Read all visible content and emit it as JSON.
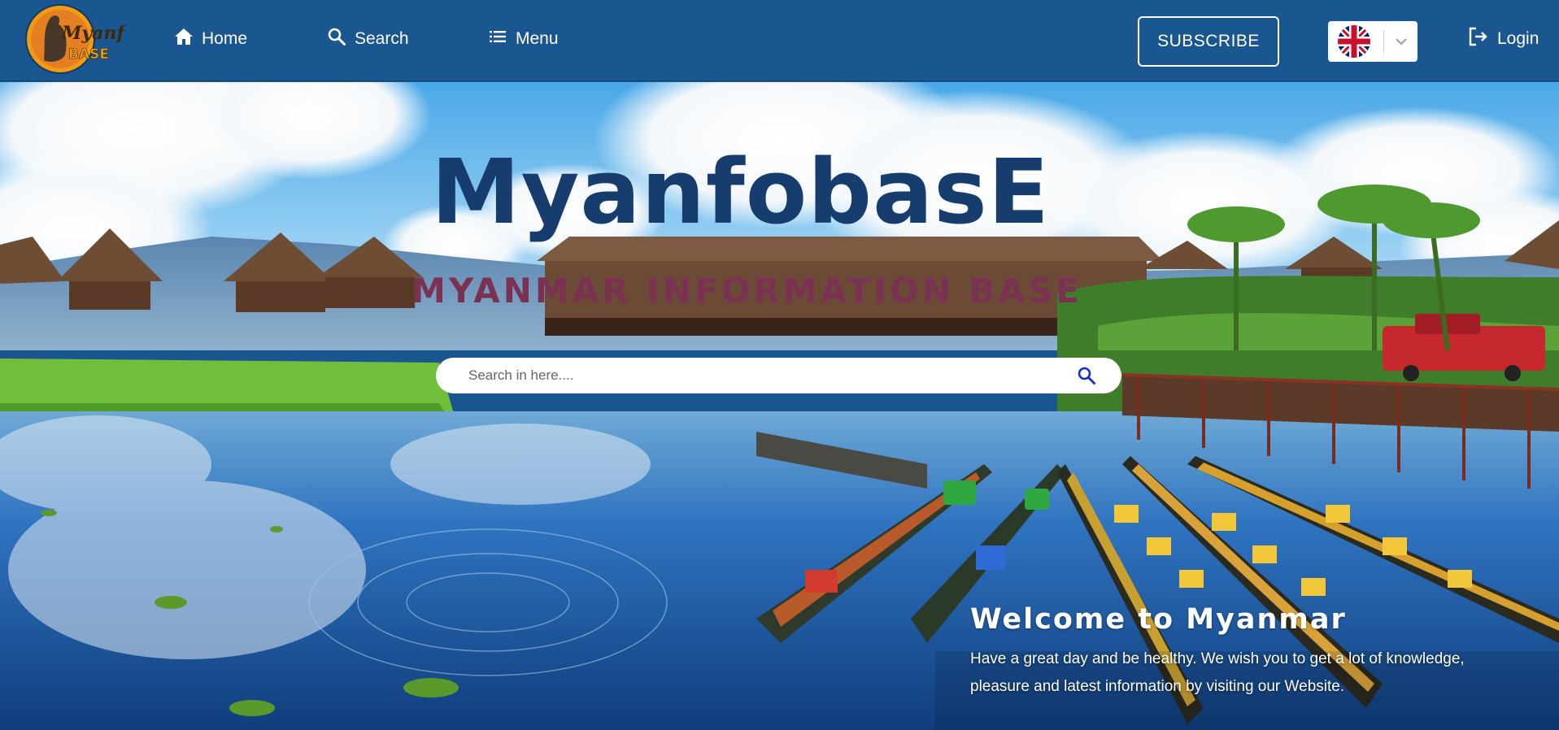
{
  "header": {
    "logo_text": "Myanfo BASE",
    "nav": [
      {
        "label": "Home",
        "icon": "home-icon"
      },
      {
        "label": "Search",
        "icon": "search-icon"
      },
      {
        "label": "Menu",
        "icon": "list-icon"
      }
    ],
    "subscribe_label": "SUBSCRIBE",
    "language": {
      "selected": "English",
      "flag": "uk-flag-icon"
    },
    "login_label": "Login"
  },
  "hero": {
    "title": "MyanfobasE",
    "subtitle": "MYANMAR INFORMATION BASE",
    "search": {
      "placeholder": "Search in here...."
    },
    "welcome_title": "Welcome to Myanmar",
    "welcome_text": "Have a great day and be healthy. We wish you to get a lot of knowledge, pleasure and latest information by visiting our Website."
  },
  "colors": {
    "header_bg": "#1a5690",
    "title": "#173d6e",
    "subtitle": "#7b3152",
    "search_icon": "#1a2fc8"
  }
}
